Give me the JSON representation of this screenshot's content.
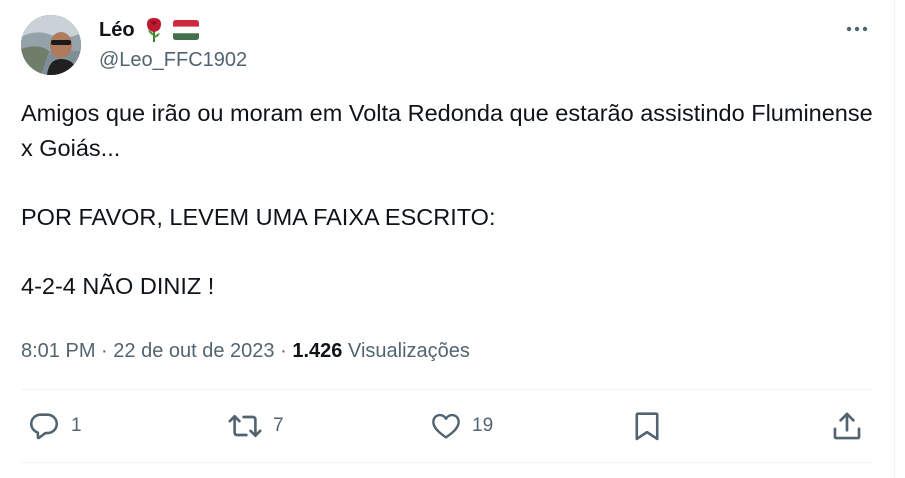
{
  "tweet": {
    "display_name": "Léo",
    "handle": "@Leo_FFC1902",
    "body": [
      "Amigos que irão ou moram em Volta Redonda que estarão assistindo Fluminense x Goiás...",
      "POR FAVOR, LEVEM UMA FAIXA ESCRITO:",
      "4-2-4 NÃO DINIZ !"
    ],
    "time": "8:01 PM",
    "date": "22 de out de 2023",
    "separator": "·",
    "views_count": "1.426",
    "views_label": "Visualizações"
  },
  "actions": {
    "reply_count": "1",
    "retweet_count": "7",
    "like_count": "19"
  },
  "icons": {
    "header_emoji_1": "rose-emoji",
    "header_emoji_2": "hungary-flag-emoji",
    "more": "more-horizontal-icon",
    "reply": "reply-icon",
    "retweet": "retweet-icon",
    "like": "heart-icon",
    "bookmark": "bookmark-icon",
    "share": "share-icon"
  },
  "colors": {
    "text_primary": "#0f1419",
    "text_secondary": "#536471",
    "divider": "#eff3f4",
    "flag_red": "#cd2a3e",
    "flag_white": "#ffffff",
    "flag_green": "#436f4d",
    "rose_red": "#be1931"
  }
}
